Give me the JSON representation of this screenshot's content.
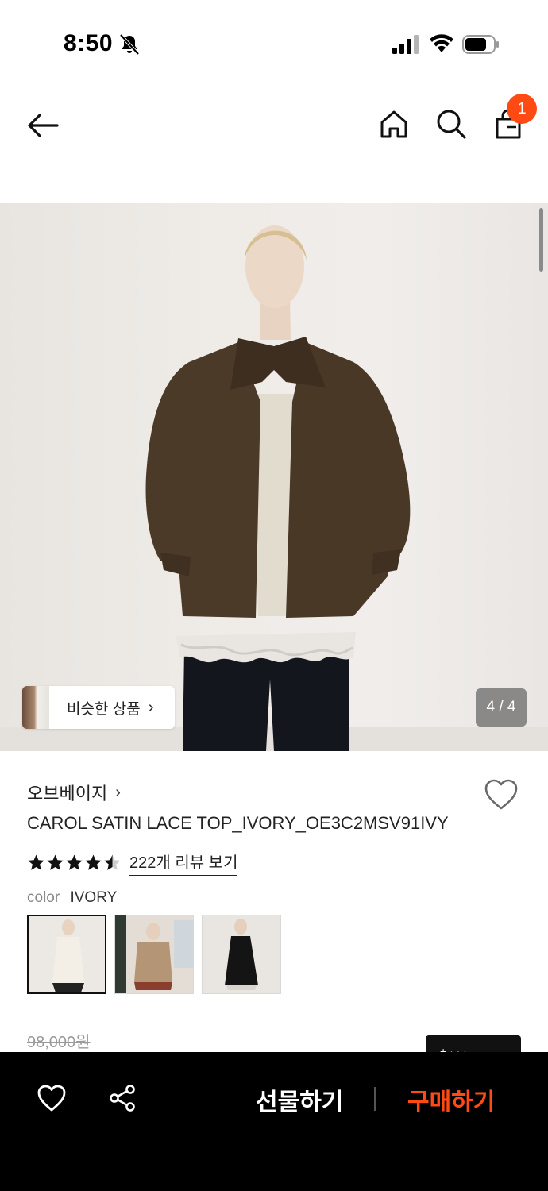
{
  "status_bar": {
    "time": "8:50"
  },
  "nav": {
    "cart_count": "1"
  },
  "hero": {
    "similar_label": "비슷한 상품",
    "page_counter": "4 / 4"
  },
  "product": {
    "brand": "오브베이지",
    "title": "CAROL SATIN LACE TOP_IVORY_OE3C2MSV91IVY",
    "rating": 4.5,
    "review_link": "222개 리뷰 보기",
    "color_label": "color",
    "color_value": "IVORY",
    "swatches": [
      "ivory",
      "beige-jacket",
      "black"
    ],
    "selected_swatch": 0,
    "original_price": "98,000원"
  },
  "bottom_bar": {
    "gift_label": "선물하기",
    "buy_label": "구매하기"
  },
  "colors": {
    "accent": "#ff4b13",
    "bottom_bar": "#000000"
  }
}
